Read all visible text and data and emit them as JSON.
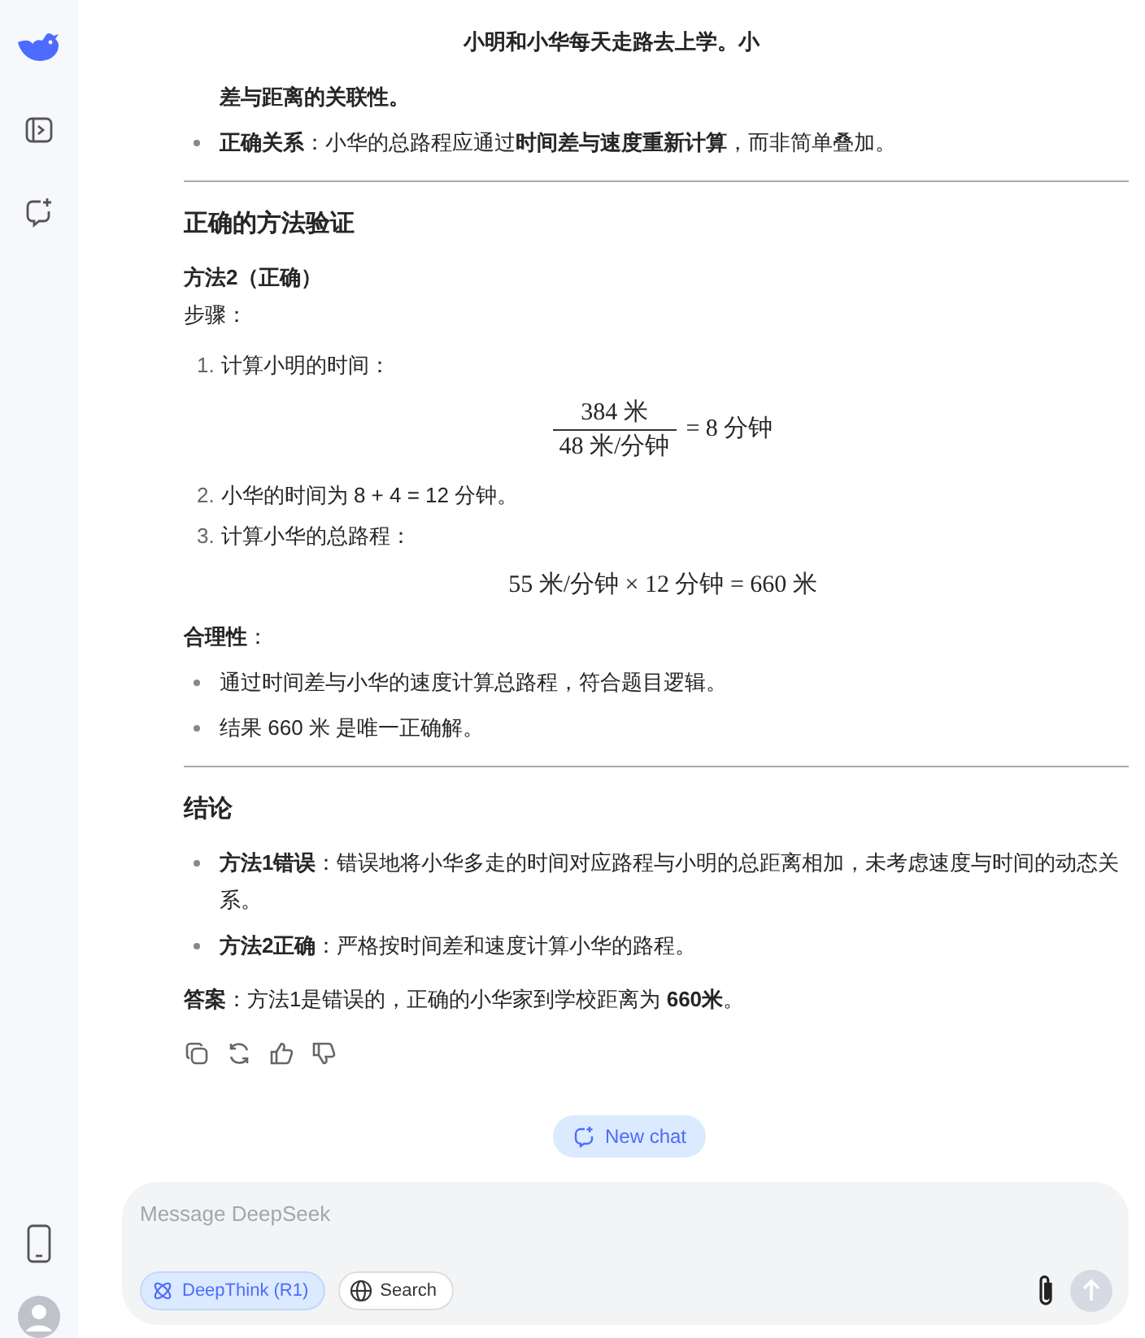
{
  "header": {
    "title": "小明和小华每天走路去上学。小"
  },
  "message": {
    "blocks": [
      {
        "kind": "continuation",
        "text": "差与距离的关联性。"
      },
      {
        "kind": "bullets",
        "items": [
          "**正确关系**：小华的总路程应通过**时间差与速度重新计算**，而非简单叠加。"
        ]
      },
      {
        "kind": "rule"
      },
      {
        "kind": "heading",
        "text": "正确的方法验证"
      },
      {
        "kind": "subheading",
        "text": "方法2（正确）"
      },
      {
        "kind": "para",
        "text": "步骤："
      },
      {
        "kind": "steps",
        "items": [
          {
            "marker": "1.",
            "text": "计算小明的时间：",
            "math": {
              "kind": "fraction",
              "numerator": "384 米",
              "denominator": "48 米/分钟",
              "rest": "= 8 分钟"
            }
          },
          {
            "marker": "2.",
            "text": "小华的时间为 8 + 4 = 12 分钟。"
          },
          {
            "marker": "3.",
            "text": "计算小华的总路程：",
            "math": {
              "kind": "line",
              "text": "55 米/分钟 × 12 分钟 = 660 米"
            }
          }
        ]
      },
      {
        "kind": "para",
        "text": "**合理性**："
      },
      {
        "kind": "bullets",
        "items": [
          "通过时间差与小华的速度计算总路程，符合题目逻辑。",
          "结果 660 米 是唯一正确解。"
        ]
      },
      {
        "kind": "rule"
      },
      {
        "kind": "heading",
        "text": "结论"
      },
      {
        "kind": "bullets",
        "items": [
          "**方法1错误**：错误地将小华多走的时间对应路程与小明的总距离相加，未考虑速度与时间的动态关系。",
          "**方法2正确**：严格按时间差和速度计算小华的路程。"
        ]
      },
      {
        "kind": "para",
        "text": "**答案**：方法1是错误的，正确的小华家到学校距离为 **660米**。"
      }
    ]
  },
  "new_chat": {
    "label": "New chat"
  },
  "composer": {
    "placeholder": "Message DeepSeek",
    "toggles": [
      {
        "kind": "deepthink",
        "label": "DeepThink (R1)",
        "selected": true
      },
      {
        "kind": "search",
        "label": "Search",
        "selected": false
      }
    ]
  }
}
